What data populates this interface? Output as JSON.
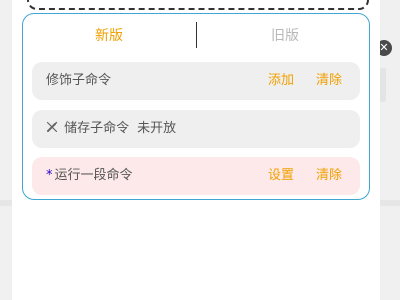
{
  "tabs": {
    "new_label": "新版",
    "old_label": "旧版",
    "active": "new"
  },
  "rows": [
    {
      "label": "修饰子命令",
      "actions": [
        "添加",
        "清除"
      ]
    },
    {
      "label": "储存子命令",
      "note": "未开放",
      "icon": "disabled-pen-icon"
    },
    {
      "marker": "*",
      "label": "运行一段命令",
      "actions": [
        "设置",
        "清除"
      ]
    }
  ],
  "close_symbol": "✕",
  "colors": {
    "accent": "#f0a000",
    "panel_border": "#3ea6d0",
    "row_bg": "#efefef",
    "highlight_row_bg": "#fde9e9",
    "marker": "#2200cc"
  }
}
